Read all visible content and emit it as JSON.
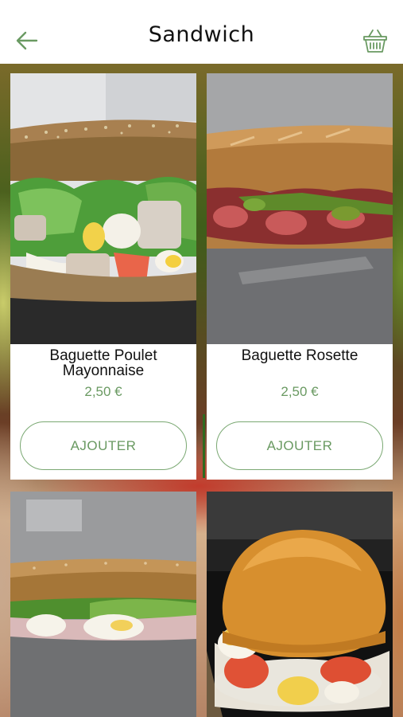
{
  "header": {
    "title": "Sandwich",
    "back_icon": "arrow-left-icon",
    "cart_icon": "basket-icon"
  },
  "colors": {
    "accent": "#6a9a62",
    "button_border": "#7aa872",
    "title_text": "#111111"
  },
  "products": [
    {
      "name": "Baguette Poulet Mayonnaise",
      "price": "2,50 €",
      "button_label": "AJOUTER",
      "image": "chicken-mayonnaise-baguette-photo"
    },
    {
      "name": "Baguette Rosette",
      "price": "2,50 €",
      "button_label": "AJOUTER",
      "image": "rosette-baguette-photo"
    },
    {
      "image": "ham-egg-baguette-photo"
    },
    {
      "image": "egg-burger-bun-photo"
    }
  ]
}
